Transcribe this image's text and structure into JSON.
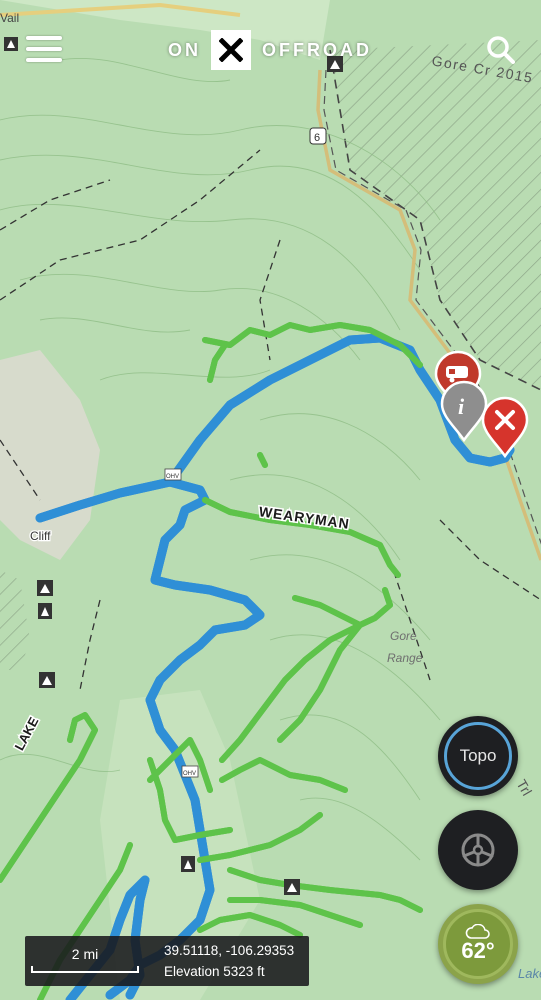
{
  "header": {
    "logo_left": "ON",
    "logo_right": "OFFROAD"
  },
  "map_labels": {
    "trail_wearyman": "WEARYMAN",
    "trail_lake": "LAKE",
    "place_cliff": "Cliff",
    "creek": "Gore Cr 2015",
    "range": "Gore\nRange",
    "trail_trl": "Trl",
    "lake": "Lake",
    "vail": "Vail",
    "ohv_1": "OHV",
    "ohv_2": "OHV",
    "route_shield": "6"
  },
  "controls": {
    "layer_label": "Topo",
    "temperature": "62°"
  },
  "info_bar": {
    "scale_label": "2 mi",
    "coordinates": "39.51118, -106.29353",
    "elevation": "Elevation 5323 ft"
  },
  "colors": {
    "map_green": "#b9dcb2",
    "trail_green": "#5ec34a",
    "route_blue": "#2f8fd6",
    "pin_red": "#d6342c",
    "pin_grey": "#8e8e8e",
    "weather_green": "#7d9a3c"
  },
  "icons": [
    "menu-icon",
    "search-icon",
    "close-icon",
    "camper-icon",
    "info-icon",
    "steering-wheel-icon",
    "cloud-icon",
    "campground-icon"
  ]
}
